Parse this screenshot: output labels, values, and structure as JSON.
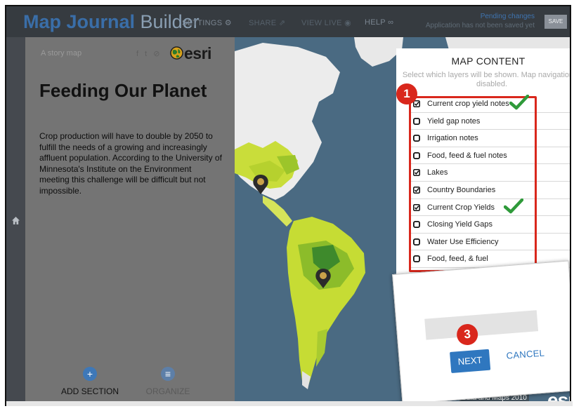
{
  "header": {
    "brand_primary": "Map Journal",
    "brand_secondary": "Builder",
    "nav": [
      {
        "label": "SETTINGS",
        "icon": "gear-icon"
      },
      {
        "label": "SHARE",
        "icon": "share-icon"
      },
      {
        "label": "VIEW LIVE",
        "icon": "eye-icon"
      },
      {
        "label": "HELP",
        "icon": "binoculars-icon"
      }
    ],
    "pending_title": "Pending changes",
    "pending_sub": "Application has not been saved yet",
    "save_label": "SAVE"
  },
  "panel": {
    "story_label": "A story map",
    "logo_text": "esri",
    "title": "Feeding Our Planet",
    "body": "Crop production will have to double by 2050 to fulfill the needs of a growing and increasingly affluent population. According to the University of Minnesota's Institute on the Environment meeting this challenge will be difficult but not impossible.",
    "add_section_label": "ADD SECTION",
    "organize_label": "ORGANIZE"
  },
  "map_content": {
    "title": "MAP CONTENT",
    "subtitle": "Select which layers will be shown. Map navigation is disabled.",
    "layers": [
      {
        "name": "Current crop yield notes",
        "checked": true
      },
      {
        "name": "Yield gap notes",
        "checked": false
      },
      {
        "name": "Irrigation notes",
        "checked": false
      },
      {
        "name": "Food, feed & fuel notes",
        "checked": false
      },
      {
        "name": "Lakes",
        "checked": true
      },
      {
        "name": "Country Boundaries",
        "checked": true
      },
      {
        "name": "Current Crop Yields",
        "checked": true
      },
      {
        "name": "Closing Yield Gaps",
        "checked": false
      },
      {
        "name": "Water Use Efficiency",
        "checked": false
      },
      {
        "name": "Food, feed, & fuel",
        "checked": false
      }
    ]
  },
  "callouts": {
    "badge_1": "1",
    "badge_3": "3"
  },
  "dialog": {
    "next_label": "NEXT",
    "cancel_label": "CANCEL"
  },
  "map": {
    "attribution": "Data and Maps 2010",
    "logo_text": "esri"
  },
  "colors": {
    "accent": "#2f77bf",
    "callout_red": "#d9271c",
    "check_green": "#2f9a3a",
    "land": "#efefef",
    "cropland": "#b7d62a",
    "ocean": "#4a6a82"
  }
}
